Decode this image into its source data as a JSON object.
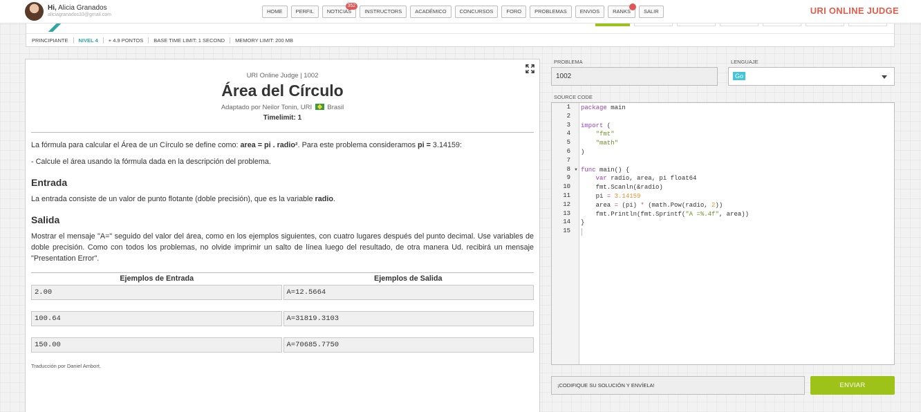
{
  "user": {
    "greeting_prefix": "Hi,",
    "name": "Alicia Granados",
    "email": "aliciagranados33@gmail.com"
  },
  "nav": [
    {
      "label": "HOME"
    },
    {
      "label": "PERFIL"
    },
    {
      "label": "NOTICIAS",
      "badge": "352"
    },
    {
      "label": "INSTRUCTORS"
    },
    {
      "label": "ACADÉMICO"
    },
    {
      "label": "CONCURSOS"
    },
    {
      "label": "FORO"
    },
    {
      "label": "PROBLEMAS"
    },
    {
      "label": "ENVIOS"
    },
    {
      "label": "RANKS",
      "dot": true
    },
    {
      "label": "SALIR"
    }
  ],
  "brand": "URI ONLINE JUDGE",
  "info": {
    "category": "PRINCIPIANTE",
    "level": "NIVEL 4",
    "points": "+ 4.9 PONTOS",
    "time_limit": "BASE TIME LIMIT: 1 SECOND",
    "memory": "MEMORY LIMIT: 200 MB"
  },
  "problem": {
    "origin": "URI Online Judge | 1002",
    "title": "Área del Círculo",
    "adapted_prefix": "Adaptado por Neilor Tonin, URI",
    "adapted_country": "Brasil",
    "timelimit": "Timelimit: 1",
    "intro_a": "La fórmula para calcular el Área de un Círculo se define como: ",
    "intro_formula": "area = pi . radio²",
    "intro_b": ". Para este problema consideramos ",
    "intro_pi": "pi =",
    "intro_c": " 3.14159:",
    "note": "- Calcule el área usando la fórmula dada en la descripción del problema.",
    "input_heading": "Entrada",
    "input_text_a": "La entrada consiste de un valor de punto flotante (doble precisión), que es la variable ",
    "input_var": "radio",
    "input_text_b": ".",
    "output_heading": "Salida",
    "output_text": "Mostrar el mensaje \"A=\" seguido del valor del área, como en los ejemplos siguientes, con cuatro lugares después del punto decimal. Use variables de doble precisión. Como con todos los problemas, no olvide imprimir un salto de línea luego del resultado, de otra manera Ud. recibirá un mensaje \"Presentation Error\".",
    "examples_input_header": "Ejemplos de Entrada",
    "examples_output_header": "Ejemplos de Salida",
    "examples": [
      {
        "input": "2.00",
        "output": "A=12.5664"
      },
      {
        "input": "100.64",
        "output": "A=31819.3103"
      },
      {
        "input": "150.00",
        "output": "A=70685.7750"
      }
    ],
    "credit": "Traducción por Daniel Ambort."
  },
  "form": {
    "problem_label": "PROBLEMA",
    "problem_value": "1002",
    "language_label": "LENGUAJE",
    "language_value": "Go",
    "source_label": "SOURCE CODE",
    "submit_message": "¡CODIFIQUE SU SOLUCIÓN Y ENVÍELA!",
    "submit_label": "ENVIAR"
  },
  "code_lines": [
    "package main",
    "",
    "import (",
    "    \"fmt\"",
    "    \"math\"",
    ")",
    "",
    "func main() {",
    "    var radio, area, pi float64",
    "    fmt.Scanln(&radio)",
    "    pi = 3.14159",
    "    area = (pi) * (math.Pow(radio, 2))",
    "    fmt.Println(fmt.Sprintf(\"A =%.4f\", area))",
    "}",
    ""
  ],
  "colors": {
    "accent": "#9dc218",
    "brand": "#e05c4b",
    "level": "#2ea7a0",
    "badge": "#e05757"
  }
}
